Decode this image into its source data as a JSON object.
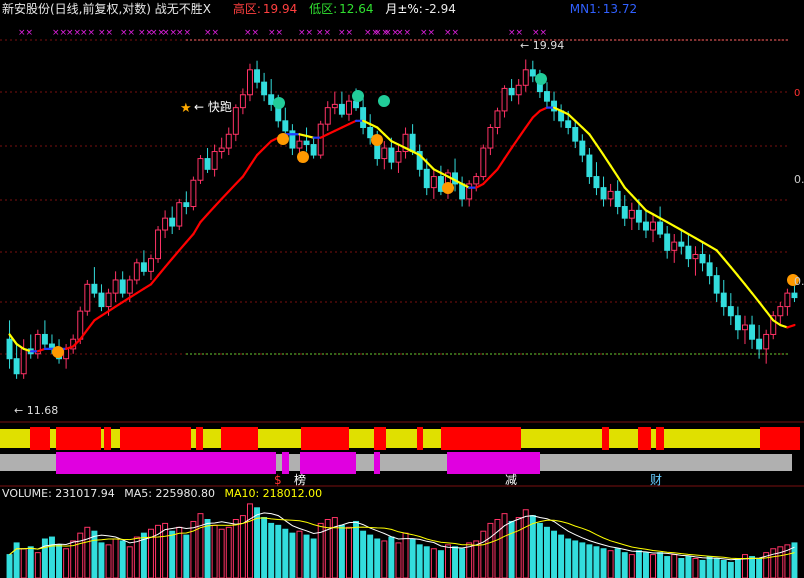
{
  "header": {
    "title": "新安股份(日线,前复权,对数) 战无不胜X",
    "high_label": "高区:",
    "high_value": "19.94",
    "low_label": "低区:",
    "low_value": "12.64",
    "month_label": "月±%:",
    "month_value": "-2.94",
    "mn_label": "MN1:",
    "mn_value": "13.72"
  },
  "annotations": {
    "max_price": "19.94",
    "min_price": "11.68",
    "run_tag": "快跑",
    "marker_x": "××",
    "bar_char_1": "$",
    "bar_char_2": "榜",
    "bar_char_3": "减",
    "bar_char_4": "财"
  },
  "axis": {
    "right_ticks": [
      "0.",
      "0."
    ]
  },
  "volume": {
    "label": "VOLUME: 231017.94",
    "ma5": "MA5: 225980.80",
    "ma10": "MA10: 218012.00"
  },
  "colors": {
    "up": "#ff3366",
    "down": "#33dddd",
    "ma_red": "#ff0000",
    "ma_yellow": "#ffff00",
    "ma_blue": "#2040ff",
    "band_yellow": "#e0e000",
    "band_red": "#ff0000",
    "band_magenta": "#e000e0",
    "band_gray": "#b0b0b0"
  },
  "chart_data": {
    "type": "candlestick",
    "title": "新安股份(日线,前复权,对数)",
    "ylim": [
      11.2,
      20.6
    ],
    "y_scale": "log",
    "candles": [
      [
        12.5,
        12.9,
        11.9,
        12.1
      ],
      [
        12.1,
        12.4,
        11.7,
        11.8
      ],
      [
        11.8,
        12.5,
        11.7,
        12.3
      ],
      [
        12.3,
        12.6,
        12.1,
        12.2
      ],
      [
        12.2,
        12.7,
        12.1,
        12.6
      ],
      [
        12.6,
        12.9,
        12.3,
        12.4
      ],
      [
        12.4,
        12.6,
        12.2,
        12.3
      ],
      [
        12.3,
        12.5,
        12.0,
        12.1
      ],
      [
        12.1,
        12.4,
        11.9,
        12.3
      ],
      [
        12.3,
        12.6,
        12.2,
        12.5
      ],
      [
        12.5,
        13.2,
        12.4,
        13.1
      ],
      [
        13.1,
        13.8,
        13.0,
        13.7
      ],
      [
        13.7,
        14.1,
        13.4,
        13.5
      ],
      [
        13.5,
        13.7,
        13.1,
        13.2
      ],
      [
        13.2,
        13.6,
        13.0,
        13.5
      ],
      [
        13.5,
        14.0,
        13.3,
        13.8
      ],
      [
        13.8,
        14.0,
        13.4,
        13.5
      ],
      [
        13.5,
        13.9,
        13.3,
        13.8
      ],
      [
        13.8,
        14.3,
        13.7,
        14.2
      ],
      [
        14.2,
        14.5,
        13.9,
        14.0
      ],
      [
        14.0,
        14.4,
        13.8,
        14.3
      ],
      [
        14.3,
        15.1,
        14.2,
        15.0
      ],
      [
        15.0,
        15.5,
        14.8,
        15.3
      ],
      [
        15.3,
        15.6,
        14.9,
        15.1
      ],
      [
        15.1,
        15.8,
        15.0,
        15.7
      ],
      [
        15.7,
        16.0,
        15.4,
        15.6
      ],
      [
        15.6,
        16.4,
        15.5,
        16.3
      ],
      [
        16.3,
        17.0,
        16.2,
        16.9
      ],
      [
        16.9,
        17.2,
        16.5,
        16.6
      ],
      [
        16.6,
        17.3,
        16.4,
        17.1
      ],
      [
        17.1,
        17.5,
        16.9,
        17.2
      ],
      [
        17.2,
        17.8,
        17.0,
        17.6
      ],
      [
        17.6,
        18.5,
        17.4,
        18.4
      ],
      [
        18.4,
        19.0,
        18.2,
        18.8
      ],
      [
        18.8,
        19.8,
        18.6,
        19.6
      ],
      [
        19.6,
        19.9,
        19.0,
        19.2
      ],
      [
        19.2,
        19.5,
        18.6,
        18.8
      ],
      [
        18.8,
        19.3,
        18.3,
        18.5
      ],
      [
        18.5,
        18.8,
        17.8,
        18.0
      ],
      [
        18.0,
        18.4,
        17.5,
        17.7
      ],
      [
        17.7,
        17.9,
        17.0,
        17.2
      ],
      [
        17.2,
        17.6,
        16.8,
        17.4
      ],
      [
        17.4,
        17.8,
        17.1,
        17.3
      ],
      [
        17.3,
        17.5,
        16.9,
        17.0
      ],
      [
        17.0,
        18.0,
        16.9,
        17.9
      ],
      [
        17.9,
        18.6,
        17.7,
        18.4
      ],
      [
        18.4,
        18.9,
        18.2,
        18.5
      ],
      [
        18.5,
        18.9,
        18.1,
        18.2
      ],
      [
        18.2,
        18.8,
        18.0,
        18.6
      ],
      [
        18.6,
        19.0,
        18.3,
        18.4
      ],
      [
        18.4,
        18.7,
        17.6,
        17.8
      ],
      [
        17.8,
        18.2,
        17.3,
        17.5
      ],
      [
        17.5,
        17.7,
        16.7,
        16.9
      ],
      [
        16.9,
        17.4,
        16.6,
        17.2
      ],
      [
        17.2,
        17.5,
        16.6,
        16.8
      ],
      [
        16.8,
        17.3,
        16.5,
        17.1
      ],
      [
        17.1,
        17.8,
        16.9,
        17.6
      ],
      [
        17.6,
        17.9,
        17.0,
        17.1
      ],
      [
        17.1,
        17.3,
        16.4,
        16.6
      ],
      [
        16.6,
        16.9,
        15.9,
        16.1
      ],
      [
        16.1,
        16.6,
        15.8,
        16.4
      ],
      [
        16.4,
        16.7,
        15.9,
        16.0
      ],
      [
        16.0,
        16.6,
        15.8,
        16.5
      ],
      [
        16.5,
        16.9,
        16.0,
        16.2
      ],
      [
        16.2,
        16.4,
        15.6,
        15.8
      ],
      [
        15.8,
        16.3,
        15.6,
        16.2
      ],
      [
        16.2,
        16.5,
        16.0,
        16.4
      ],
      [
        16.4,
        17.3,
        16.3,
        17.2
      ],
      [
        17.2,
        17.9,
        17.0,
        17.8
      ],
      [
        17.8,
        18.4,
        17.6,
        18.3
      ],
      [
        18.3,
        19.1,
        18.1,
        19.0
      ],
      [
        19.0,
        19.3,
        18.6,
        18.8
      ],
      [
        18.8,
        19.3,
        18.5,
        19.1
      ],
      [
        19.1,
        19.94,
        18.9,
        19.6
      ],
      [
        19.6,
        19.9,
        19.2,
        19.4
      ],
      [
        19.4,
        19.6,
        18.7,
        18.9
      ],
      [
        18.9,
        19.2,
        18.4,
        18.6
      ],
      [
        18.6,
        18.9,
        18.0,
        18.3
      ],
      [
        18.3,
        18.5,
        17.8,
        18.0
      ],
      [
        18.0,
        18.3,
        17.6,
        17.8
      ],
      [
        17.8,
        18.0,
        17.2,
        17.4
      ],
      [
        17.4,
        17.6,
        16.8,
        17.0
      ],
      [
        17.0,
        17.2,
        16.2,
        16.4
      ],
      [
        16.4,
        16.8,
        15.9,
        16.1
      ],
      [
        16.1,
        16.4,
        15.6,
        15.8
      ],
      [
        15.8,
        16.2,
        15.6,
        16.0
      ],
      [
        16.0,
        16.3,
        15.4,
        15.6
      ],
      [
        15.6,
        15.9,
        15.1,
        15.3
      ],
      [
        15.3,
        15.7,
        15.0,
        15.5
      ],
      [
        15.5,
        15.8,
        15.0,
        15.2
      ],
      [
        15.2,
        15.5,
        14.8,
        15.0
      ],
      [
        15.0,
        15.4,
        14.7,
        15.2
      ],
      [
        15.2,
        15.6,
        14.8,
        14.9
      ],
      [
        14.9,
        15.1,
        14.3,
        14.5
      ],
      [
        14.5,
        14.9,
        14.2,
        14.7
      ],
      [
        14.7,
        15.0,
        14.4,
        14.6
      ],
      [
        14.6,
        14.9,
        14.1,
        14.3
      ],
      [
        14.3,
        14.6,
        13.9,
        14.4
      ],
      [
        14.4,
        14.7,
        14.0,
        14.2
      ],
      [
        14.2,
        14.4,
        13.7,
        13.9
      ],
      [
        13.9,
        14.1,
        13.3,
        13.5
      ],
      [
        13.5,
        13.8,
        13.0,
        13.2
      ],
      [
        13.2,
        13.5,
        12.8,
        13.0
      ],
      [
        13.0,
        13.2,
        12.5,
        12.7
      ],
      [
        12.7,
        13.0,
        12.4,
        12.8
      ],
      [
        12.8,
        13.0,
        12.3,
        12.5
      ],
      [
        12.5,
        12.8,
        12.1,
        12.3
      ],
      [
        12.3,
        12.7,
        12.0,
        12.6
      ],
      [
        12.6,
        13.1,
        12.5,
        13.0
      ],
      [
        13.0,
        13.3,
        12.8,
        13.2
      ],
      [
        13.2,
        13.6,
        13.0,
        13.5
      ],
      [
        13.5,
        13.8,
        13.3,
        13.4
      ]
    ],
    "ma_line": [
      12.6,
      12.4,
      12.3,
      12.25,
      12.25,
      12.3,
      12.3,
      12.3,
      12.3,
      12.35,
      12.5,
      12.7,
      12.9,
      13.0,
      13.1,
      13.2,
      13.3,
      13.4,
      13.5,
      13.6,
      13.7,
      13.9,
      14.1,
      14.3,
      14.5,
      14.7,
      14.9,
      15.2,
      15.4,
      15.6,
      15.8,
      16.0,
      16.2,
      16.4,
      16.7,
      17.0,
      17.2,
      17.4,
      17.5,
      17.6,
      17.6,
      17.6,
      17.55,
      17.5,
      17.5,
      17.6,
      17.7,
      17.8,
      17.9,
      18.0,
      18.0,
      17.9,
      17.8,
      17.6,
      17.4,
      17.3,
      17.2,
      17.1,
      17.0,
      16.8,
      16.6,
      16.5,
      16.4,
      16.3,
      16.2,
      16.1,
      16.1,
      16.2,
      16.4,
      16.6,
      16.9,
      17.2,
      17.5,
      17.8,
      18.1,
      18.3,
      18.4,
      18.4,
      18.3,
      18.2,
      18.0,
      17.8,
      17.6,
      17.3,
      17.0,
      16.7,
      16.4,
      16.1,
      15.9,
      15.7,
      15.5,
      15.4,
      15.3,
      15.2,
      15.1,
      15.0,
      14.9,
      14.8,
      14.7,
      14.6,
      14.5,
      14.3,
      14.1,
      13.9,
      13.7,
      13.5,
      13.3,
      13.1,
      12.9,
      12.8,
      12.75,
      12.8
    ],
    "volume": [
      120,
      180,
      150,
      160,
      130,
      200,
      210,
      170,
      150,
      190,
      230,
      260,
      240,
      180,
      170,
      200,
      190,
      160,
      210,
      230,
      250,
      270,
      280,
      240,
      260,
      220,
      290,
      330,
      300,
      270,
      250,
      260,
      300,
      320,
      380,
      360,
      310,
      280,
      270,
      250,
      230,
      240,
      220,
      200,
      280,
      300,
      310,
      270,
      260,
      290,
      240,
      220,
      200,
      190,
      210,
      180,
      230,
      200,
      170,
      160,
      150,
      140,
      170,
      160,
      150,
      180,
      190,
      240,
      280,
      300,
      330,
      290,
      310,
      350,
      320,
      280,
      260,
      240,
      220,
      200,
      190,
      180,
      170,
      160,
      150,
      140,
      150,
      130,
      120,
      140,
      130,
      120,
      130,
      110,
      120,
      100,
      110,
      100,
      90,
      110,
      100,
      90,
      80,
      100,
      120,
      110,
      100,
      130,
      150,
      160,
      170,
      180
    ]
  }
}
